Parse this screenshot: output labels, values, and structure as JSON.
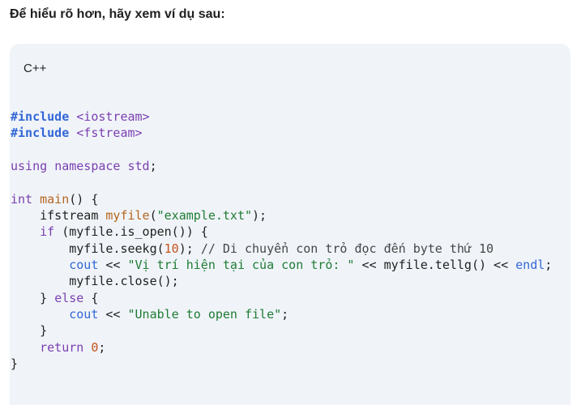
{
  "heading": "Để hiểu rõ hơn, hãy xem ví dụ sau:",
  "code_block": {
    "language": "C++",
    "lines": [
      "#include <iostream>",
      "#include <fstream>",
      "",
      "using namespace std;",
      "",
      "int main() {",
      "    ifstream myfile(\"example.txt\");",
      "    if (myfile.is_open()) {",
      "        myfile.seekg(10); // Di chuyển con trỏ đọc đến byte thứ 10",
      "        cout << \"Vị trí hiện tại của con trỏ: \" << myfile.tellg() << endl;",
      "        myfile.close();",
      "    } else {",
      "        cout << \"Unable to open file\";",
      "    }",
      "    return 0;",
      "}"
    ]
  },
  "colors": {
    "background": "#ffffff",
    "code_background": "#f0f4f9",
    "preprocessor": "#3367d6",
    "keyword": "#7a3fb0",
    "string": "#1e7b34",
    "number": "#c5531a",
    "function": "#b5651d"
  }
}
